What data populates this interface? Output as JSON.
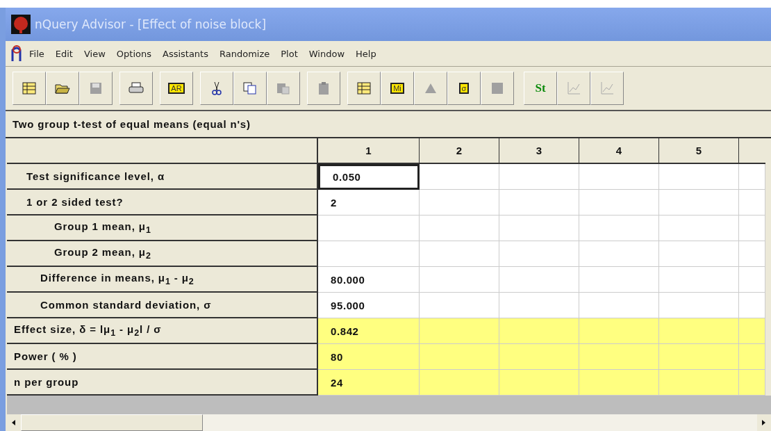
{
  "window": {
    "title": "nQuery Advisor - [Effect of noise block]"
  },
  "menu": [
    "File",
    "Edit",
    "View",
    "Options",
    "Assistants",
    "Randomize",
    "Plot",
    "Window",
    "Help"
  ],
  "toolbar": [
    {
      "kind": "grid",
      "disabled": false
    },
    {
      "kind": "open",
      "disabled": false
    },
    {
      "kind": "save",
      "disabled": true
    },
    {
      "kind": "print",
      "disabled": false
    },
    {
      "kind": "badge",
      "label": "AR",
      "disabled": false
    },
    {
      "kind": "cut",
      "disabled": false
    },
    {
      "kind": "copy",
      "disabled": false
    },
    {
      "kind": "paste",
      "disabled": true
    },
    {
      "kind": "clipboard",
      "disabled": true
    },
    {
      "kind": "grid",
      "disabled": false
    },
    {
      "kind": "badge",
      "label": "Mi",
      "disabled": false
    },
    {
      "kind": "triangle",
      "disabled": true
    },
    {
      "kind": "badge",
      "label": "σ",
      "disabled": false
    },
    {
      "kind": "square",
      "disabled": true
    },
    {
      "kind": "text",
      "label": "St",
      "disabled": false
    },
    {
      "kind": "chart",
      "disabled": true
    },
    {
      "kind": "chart",
      "disabled": true
    }
  ],
  "table": {
    "title": "Two group t-test of equal means (equal n's)",
    "columns": [
      "1",
      "2",
      "3",
      "4",
      "5"
    ],
    "rows": [
      {
        "label": "Test significance level, α",
        "kind": "input",
        "value": "0.050",
        "selected": true
      },
      {
        "label": "1 or 2 sided test?",
        "kind": "input",
        "value": "2",
        "selected": false
      },
      {
        "label": "Group 1 mean, μ$_{1}$",
        "kind": "mean",
        "selected": false
      },
      {
        "label": "Group 2 mean, μ$_{2}$",
        "kind": "mean",
        "selected": false
      },
      {
        "label": "Difference in means, μ$_{1}$ - μ$_{2}$",
        "kind": "parameter",
        "value": "80.000",
        "selected": false
      },
      {
        "label": "Common standard deviation, σ",
        "kind": "parameter",
        "value": "95.000",
        "selected": false
      },
      {
        "label": "Effect size, δ = lμ$_{1}$ - μ$_{2}$l / σ",
        "kind": "result",
        "value": "0.842",
        "selected": false
      },
      {
        "label": "Power ( % )",
        "kind": "result",
        "value": "80",
        "selected": false
      },
      {
        "label": "n per group",
        "kind": "result",
        "value": "24",
        "selected": false
      }
    ]
  }
}
